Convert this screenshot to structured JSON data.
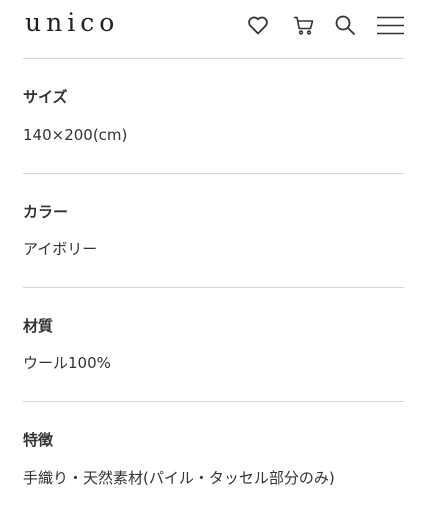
{
  "header": {
    "logo": "unico",
    "icons": [
      "heart-icon",
      "cart-icon",
      "search-icon",
      "menu-icon"
    ]
  },
  "specs": [
    {
      "label": "サイズ",
      "value": "140×200(cm)"
    },
    {
      "label": "カラー",
      "value": "アイボリー"
    },
    {
      "label": "材質",
      "value": "ウール100%"
    },
    {
      "label": "特徴",
      "value": "手織り・天然素材(パイル・タッセル部分のみ)"
    }
  ]
}
